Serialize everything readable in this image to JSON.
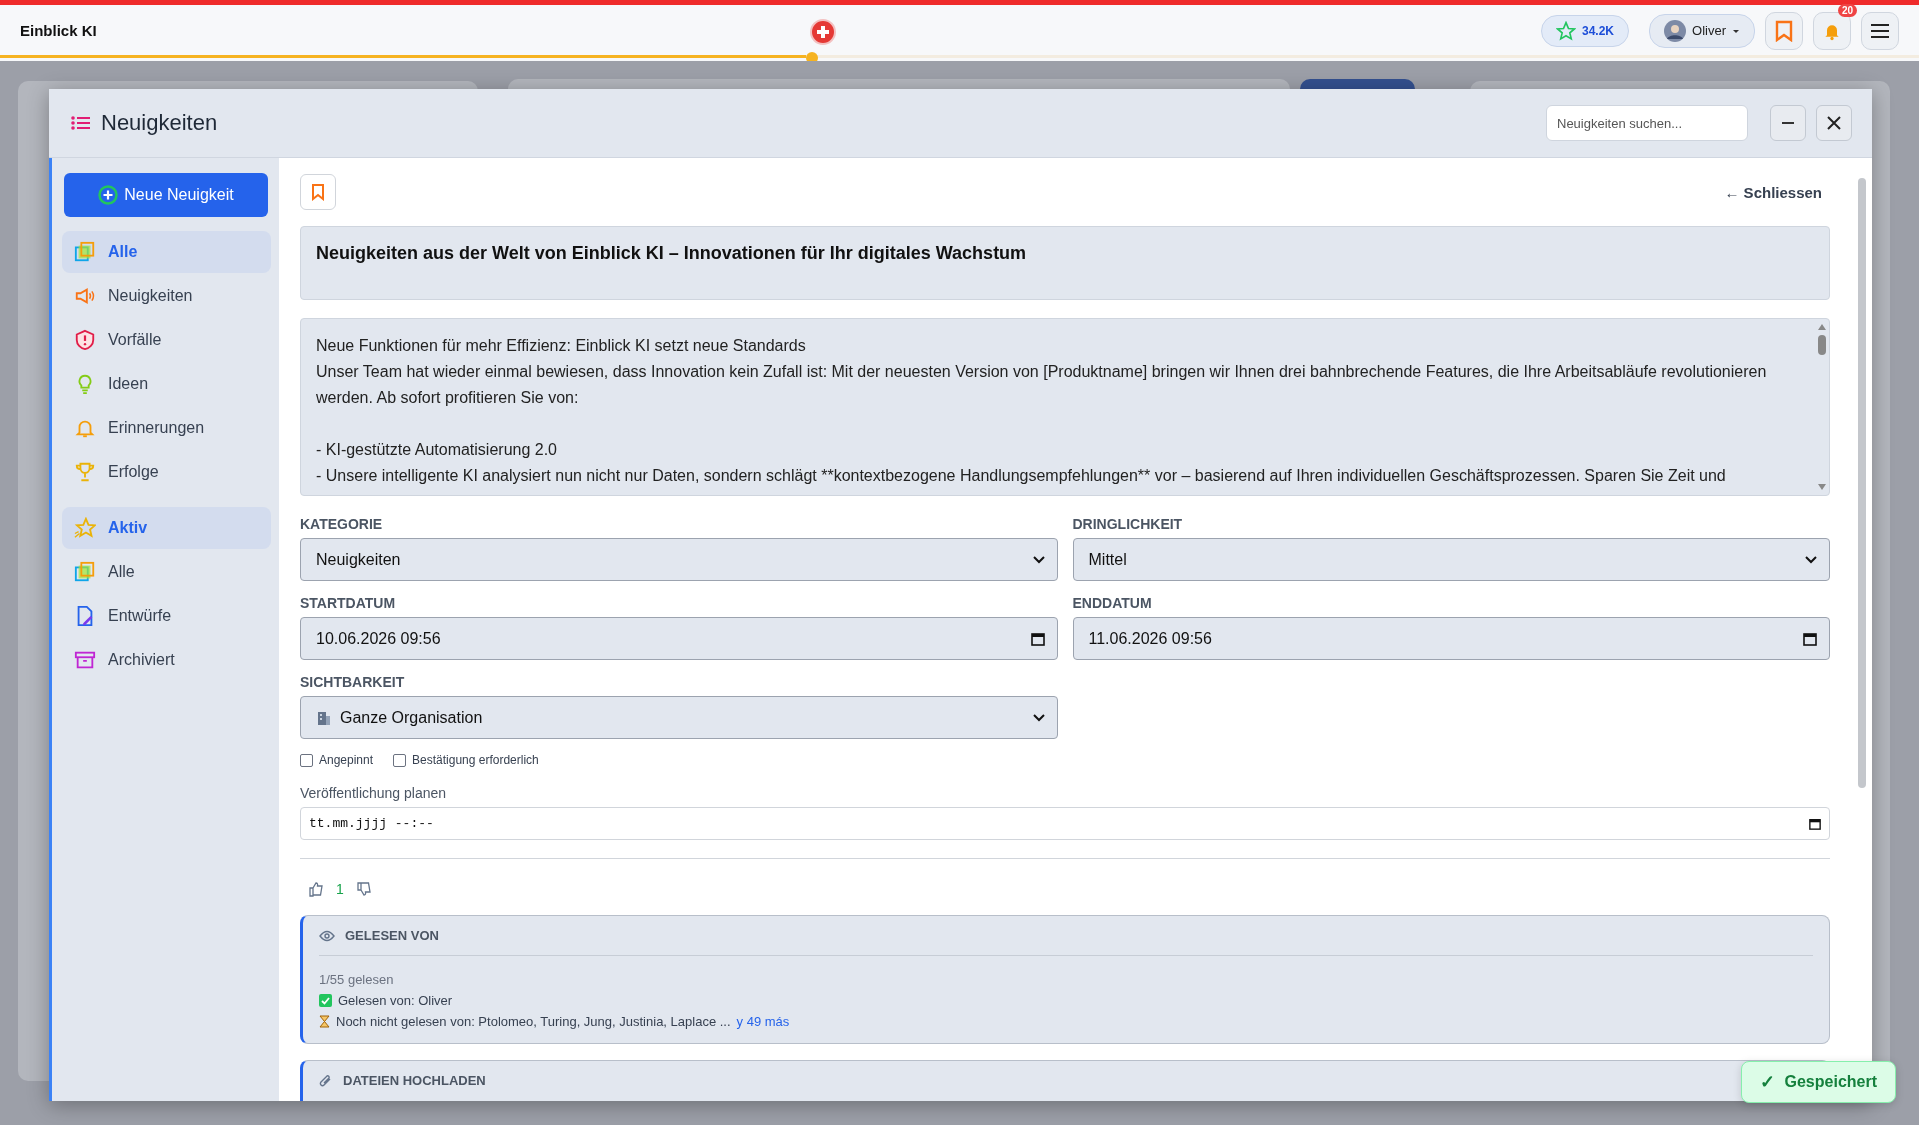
{
  "topbar": {
    "brand": "Einblick KI",
    "progress": {
      "level": 0.42
    },
    "star_count": "34.2K",
    "user": "Oliver",
    "notification_count": "20"
  },
  "modal": {
    "title": "Neuigkeiten",
    "search": {
      "placeholder": "Neuigkeiten suchen..."
    },
    "sidebar": {
      "new_button": "Neue Neuigkeit",
      "groups": [
        {
          "items": [
            {
              "label": "Alle",
              "kind": "stack",
              "selected": true
            },
            {
              "label": "Neuigkeiten",
              "kind": "megaphone",
              "selected": false
            },
            {
              "label": "Vorfälle",
              "kind": "shield",
              "selected": false
            },
            {
              "label": "Ideen",
              "kind": "bulb",
              "selected": false
            },
            {
              "label": "Erinnerungen",
              "kind": "bell",
              "selected": false
            },
            {
              "label": "Erfolge",
              "kind": "trophy",
              "selected": false
            }
          ]
        },
        {
          "items": [
            {
              "label": "Aktiv",
              "kind": "star",
              "selected": true
            },
            {
              "label": "Alle",
              "kind": "stack",
              "selected": false
            },
            {
              "label": "Entwürfe",
              "kind": "draft",
              "selected": false
            },
            {
              "label": "Archiviert",
              "kind": "archive",
              "selected": false
            }
          ]
        }
      ]
    },
    "editor": {
      "close_link": "← Schliessen",
      "title": "Neuigkeiten aus der Welt von Einblick KI – Innovationen für Ihr digitales Wachstum",
      "body_lines": [
        "Neue Funktionen für mehr Effizienz: Einblick KI setzt neue Standards",
        "Unser Team hat wieder einmal bewiesen, dass Innovation kein Zufall ist: Mit der neuesten Version von [Produktname] bringen wir Ihnen drei bahnbrechende Features, die Ihre Arbeitsabläufe revolutionieren werden. Ab sofort profitieren Sie von:",
        "- KI-gestützte Automatisierung 2.0",
        "- Unsere intelligente KI analysiert nun nicht nur Daten, sondern schlägt **kontextbezogene Handlungsempfehlungen** vor – basierend auf Ihren individuellen Geschäftsprozessen. Sparen Sie Zeit und"
      ],
      "fields": [
        {
          "label": "KATEGORIE",
          "kind": "select",
          "value": "Neuigkeiten"
        },
        {
          "label": "DRINGLICHKEIT",
          "kind": "select",
          "value": "Mittel"
        },
        {
          "label": "STARTDATUM",
          "kind": "date",
          "value": "10.06.2026 09:56"
        },
        {
          "label": "ENDDATUM",
          "kind": "date",
          "value": "11.06.2026 09:56"
        },
        {
          "label": "SICHTBARKEIT",
          "kind": "select-building",
          "value": "Ganze Organisation"
        }
      ],
      "checkboxes": [
        {
          "label": "Angepinnt",
          "checked": false
        },
        {
          "label": "Bestätigung erforderlich",
          "checked": false
        }
      ],
      "schedule": {
        "label": "Veröffentlichung planen",
        "placeholder": "tt.mm.jjjj --:--"
      },
      "likes": "1",
      "read_card": {
        "heading": "GELESEN VON",
        "count": "1/55 gelesen",
        "read_by": "Gelesen von: Oliver",
        "not_read": "Noch nicht gelesen von: Ptolomeo, Turing, Jung, Justinia, Laplace ...",
        "more_link": "y 49 más"
      },
      "upload_card": {
        "heading": "DATEIEN HOCHLADEN"
      }
    }
  },
  "toast": {
    "icon": "✓",
    "text": "Gespeichert"
  }
}
